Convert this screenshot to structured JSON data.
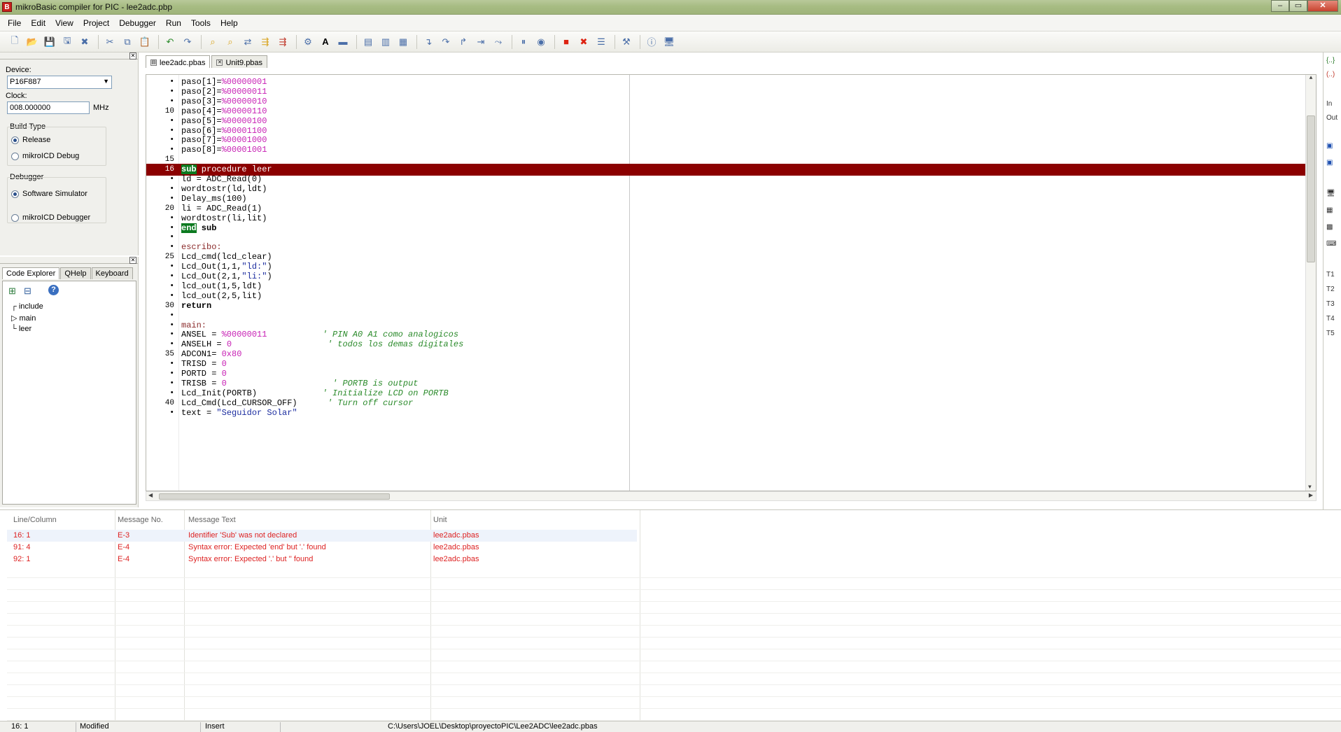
{
  "window": {
    "title": "mikroBasic compiler for PIC - lee2adc.pbp",
    "app_icon": "B"
  },
  "menu": [
    "File",
    "Edit",
    "View",
    "Project",
    "Debugger",
    "Run",
    "Tools",
    "Help"
  ],
  "toolbar_icons": [
    "new-file",
    "open-file",
    "save",
    "save-all",
    "close-file",
    "cut",
    "copy",
    "paste",
    "undo",
    "redo",
    "find",
    "find-next",
    "replace",
    "find-in-files",
    "build",
    "font",
    "toggle-view",
    "comment",
    "uncomment",
    "indent",
    "step-into",
    "step-over",
    "step-out",
    "run-to-cursor",
    "jump",
    "pause",
    "breakpoint",
    "stop",
    "clear-breakpoints",
    "watch",
    "options",
    "help",
    "about"
  ],
  "project_settings": {
    "device_label": "Device:",
    "device_value": "P16F887",
    "clock_label": "Clock:",
    "clock_value": "008.000000",
    "clock_unit": "MHz",
    "build_type_label": "Build Type",
    "build_release": "Release",
    "build_icd": "mikroICD Debug",
    "debugger_label": "Debugger",
    "debugger_sim": "Software Simulator",
    "debugger_icd": "mikroICD Debugger"
  },
  "code_explorer": {
    "tabs": [
      "Code Explorer",
      "QHelp",
      "Keyboard"
    ],
    "tree": [
      "include",
      "main",
      "leer"
    ]
  },
  "editor": {
    "tabs": [
      "lee2adc.pbas",
      "Unit9.pbas"
    ],
    "error_line": 16
  },
  "code_lines": [
    {
      "n": "",
      "parts": [
        [
          "t",
          "paso[1]="
        ],
        [
          "bin",
          "%00000001"
        ]
      ]
    },
    {
      "n": "",
      "parts": [
        [
          "t",
          "paso[2]="
        ],
        [
          "bin",
          "%00000011"
        ]
      ]
    },
    {
      "n": "",
      "parts": [
        [
          "t",
          "paso[3]="
        ],
        [
          "bin",
          "%00000010"
        ]
      ]
    },
    {
      "n": "10",
      "parts": [
        [
          "t",
          "paso[4]="
        ],
        [
          "bin",
          "%00000110"
        ]
      ]
    },
    {
      "n": "",
      "parts": [
        [
          "t",
          "paso[5]="
        ],
        [
          "bin",
          "%00000100"
        ]
      ]
    },
    {
      "n": "",
      "parts": [
        [
          "t",
          "paso[6]="
        ],
        [
          "bin",
          "%00001100"
        ]
      ]
    },
    {
      "n": "",
      "parts": [
        [
          "t",
          "paso[7]="
        ],
        [
          "bin",
          "%00001000"
        ]
      ]
    },
    {
      "n": "",
      "parts": [
        [
          "t",
          "paso[8]="
        ],
        [
          "bin",
          "%00001001"
        ]
      ]
    },
    {
      "n": "15",
      "parts": [
        [
          "t",
          ""
        ]
      ]
    },
    {
      "n": "16",
      "parts": [
        [
          "kwbox",
          "sub"
        ],
        [
          "t",
          " procedure leer"
        ]
      ]
    },
    {
      "n": "",
      "parts": [
        [
          "t",
          "ld = ADC_Read(0)"
        ]
      ]
    },
    {
      "n": "",
      "parts": [
        [
          "t",
          "wordtostr(ld,ldt)"
        ]
      ]
    },
    {
      "n": "",
      "parts": [
        [
          "t",
          "Delay_ms(100)"
        ]
      ]
    },
    {
      "n": "20",
      "parts": [
        [
          "t",
          "li = ADC_Read(1)"
        ]
      ]
    },
    {
      "n": "",
      "parts": [
        [
          "t",
          "wordtostr(li,lit)"
        ]
      ]
    },
    {
      "n": "",
      "parts": [
        [
          "kwbox",
          "end"
        ],
        [
          "kw",
          " sub"
        ]
      ]
    },
    {
      "n": "",
      "parts": [
        [
          "t",
          ""
        ]
      ]
    },
    {
      "n": "",
      "parts": [
        [
          "lbl",
          "escribo:"
        ]
      ]
    },
    {
      "n": "25",
      "parts": [
        [
          "t",
          "Lcd_cmd(lcd_clear)"
        ]
      ]
    },
    {
      "n": "",
      "parts": [
        [
          "t",
          "Lcd_Out(1,1,"
        ],
        [
          "str",
          "\"ld:\""
        ],
        [
          "t",
          ")"
        ]
      ]
    },
    {
      "n": "",
      "parts": [
        [
          "t",
          "Lcd_Out(2,1,"
        ],
        [
          "str",
          "\"li:\""
        ],
        [
          "t",
          ")"
        ]
      ]
    },
    {
      "n": "",
      "parts": [
        [
          "t",
          "lcd_out(1,5,ldt)"
        ]
      ]
    },
    {
      "n": "",
      "parts": [
        [
          "t",
          "lcd_out(2,5,lit)"
        ]
      ]
    },
    {
      "n": "30",
      "parts": [
        [
          "kw",
          "return"
        ]
      ]
    },
    {
      "n": "",
      "parts": [
        [
          "t",
          ""
        ]
      ]
    },
    {
      "n": "",
      "parts": [
        [
          "lbl",
          "main:"
        ]
      ]
    },
    {
      "n": "",
      "parts": [
        [
          "t",
          "ANSEL = "
        ],
        [
          "bin",
          "%00000011"
        ],
        [
          "t",
          "           "
        ],
        [
          "cmt",
          "' PIN A0 A1 como analogicos"
        ]
      ]
    },
    {
      "n": "",
      "parts": [
        [
          "t",
          "ANSELH = "
        ],
        [
          "bin",
          "0"
        ],
        [
          "t",
          "                   "
        ],
        [
          "cmt",
          "' todos los demas digitales"
        ]
      ]
    },
    {
      "n": "35",
      "parts": [
        [
          "t",
          "ADCON1= "
        ],
        [
          "bin",
          "0x80"
        ]
      ]
    },
    {
      "n": "",
      "parts": [
        [
          "t",
          "TRISD = "
        ],
        [
          "bin",
          "0"
        ]
      ]
    },
    {
      "n": "",
      "parts": [
        [
          "t",
          "PORTD = "
        ],
        [
          "bin",
          "0"
        ]
      ]
    },
    {
      "n": "",
      "parts": [
        [
          "t",
          "TRISB = "
        ],
        [
          "bin",
          "0"
        ],
        [
          "t",
          "                     "
        ],
        [
          "cmt",
          "' PORTB is output"
        ]
      ]
    },
    {
      "n": "",
      "parts": [
        [
          "t",
          "Lcd_Init(PORTB)             "
        ],
        [
          "cmt",
          "' Initialize LCD on PORTB"
        ]
      ]
    },
    {
      "n": "40",
      "parts": [
        [
          "t",
          "Lcd_Cmd(Lcd_CURSOR_OFF)      "
        ],
        [
          "cmt",
          "' Turn off cursor"
        ]
      ]
    },
    {
      "n": "",
      "parts": [
        [
          "t",
          "text = "
        ],
        [
          "str",
          "\"Seguidor Solar\""
        ]
      ]
    }
  ],
  "messages": {
    "headers": [
      "Line/Column",
      "Message No.",
      "Message Text",
      "Unit"
    ],
    "rows": [
      {
        "pos": "16: 1",
        "no": "E-3",
        "text": "Identifier 'Sub' was not declared",
        "unit": "lee2adc.pbas"
      },
      {
        "pos": "91: 4",
        "no": "E-4",
        "text": "Syntax error: Expected 'end' but '.' found",
        "unit": "lee2adc.pbas"
      },
      {
        "pos": "92: 1",
        "no": "E-4",
        "text": "Syntax error: Expected '.' but '' found",
        "unit": "lee2adc.pbas"
      }
    ]
  },
  "rightbar": [
    "{..}",
    "(..)",
    "In",
    "Out",
    "T1",
    "T2",
    "T3",
    "T4",
    "T5"
  ],
  "status": {
    "position": "16: 1",
    "modified": "Modified",
    "mode": "Insert",
    "path": "C:\\Users\\JOEL\\Desktop\\proyectoPIC\\Lee2ADC\\lee2adc.pbas"
  },
  "colors": {
    "error_line": "#8b0000",
    "keyword_box": "#0c7a20",
    "message_text": "#dd2222"
  }
}
